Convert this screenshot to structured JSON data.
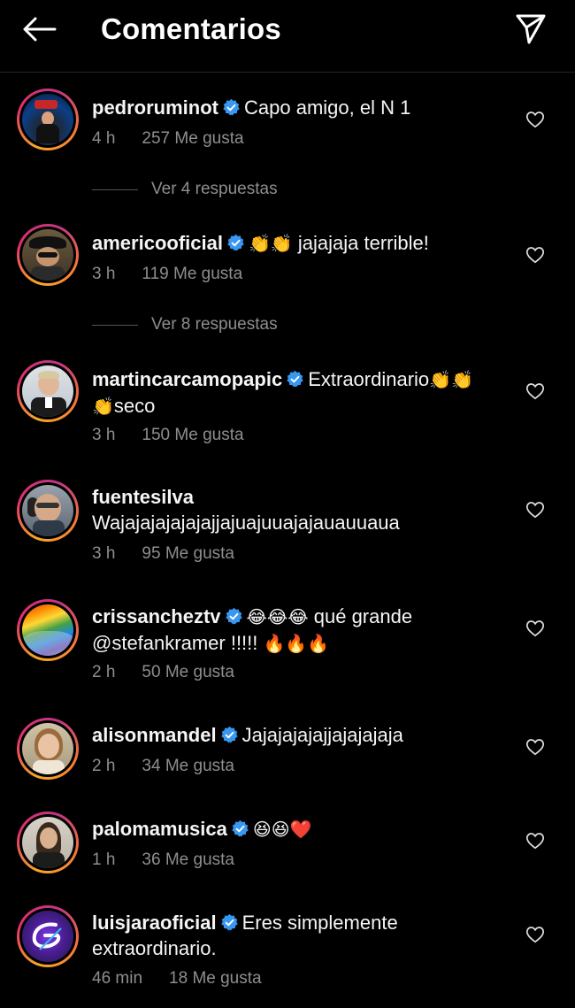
{
  "header": {
    "title": "Comentarios"
  },
  "comments": [
    {
      "username": "pedroruminot",
      "verified": true,
      "text": "Capo amigo, el N 1",
      "time": "4 h",
      "likes": "257 Me gusta",
      "replies": "Ver 4 respuestas"
    },
    {
      "username": "americooficial",
      "verified": true,
      "emoji": "👏👏",
      "text": " jajajaja terrible!",
      "time": "3 h",
      "likes": "119 Me gusta",
      "replies": "Ver 8 respuestas"
    },
    {
      "username": "martincarcamopapic",
      "verified": true,
      "text": "Extraordinario",
      "emoji": "👏👏",
      "emoji2": "👏",
      "text2": "seco",
      "time": "3 h",
      "likes": "150 Me gusta"
    },
    {
      "username": "fuentesilva",
      "verified": false,
      "text": "Wajajajajajajajjajuajuuajajauauuaua",
      "time": "3 h",
      "likes": "95 Me gusta"
    },
    {
      "username": "crissancheztv",
      "verified": true,
      "emoji": "😂😂😂",
      "text": " qué grande @stefankramer !!!!! ",
      "emoji2": "🔥🔥🔥",
      "time": "2 h",
      "likes": "50 Me gusta"
    },
    {
      "username": "alisonmandel",
      "verified": true,
      "text": "Jajajajajajjajajajaja",
      "time": "2 h",
      "likes": "34 Me gusta"
    },
    {
      "username": "palomamusica",
      "verified": true,
      "emoji": "😆😆❤️",
      "time": "1 h",
      "likes": "36 Me gusta"
    },
    {
      "username": "luisjaraoficial",
      "verified": true,
      "text": "Eres simplemente extraordinario.",
      "time": "46 min",
      "likes": "18 Me gusta"
    }
  ],
  "icons": {
    "back": "arrow-left-icon",
    "share": "send-icon",
    "verified": "verified-badge-icon",
    "like": "heart-outline-icon"
  },
  "colors": {
    "background": "#000000",
    "text": "#f5f5f5",
    "meta": "#8e8e8e",
    "verified": "#3897f0"
  }
}
